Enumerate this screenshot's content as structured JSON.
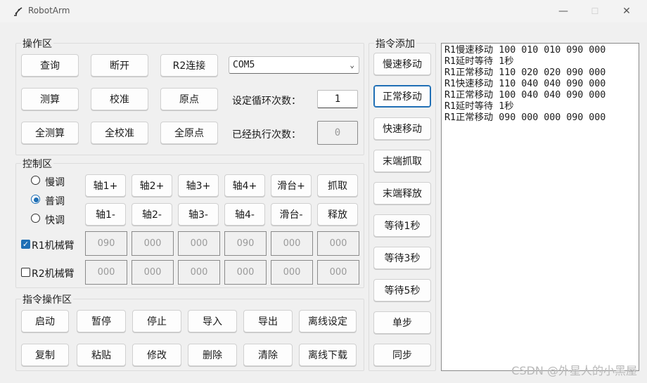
{
  "window": {
    "title": "RobotArm",
    "minimize": "—",
    "maximize": "☐",
    "close": "✕"
  },
  "operation": {
    "title": "操作区",
    "buttons": [
      [
        "查询",
        "断开",
        "R2连接"
      ],
      [
        "测算",
        "校准",
        "原点"
      ],
      [
        "全测算",
        "全校准",
        "全原点"
      ]
    ],
    "port": "COM5",
    "loop_label": "设定循环次数：",
    "loop_value": "1",
    "executed_label": "已经执行次数：",
    "executed_value": "0"
  },
  "control": {
    "title": "控制区",
    "speeds": [
      {
        "label": "慢调",
        "checked": false
      },
      {
        "label": "普调",
        "checked": true
      },
      {
        "label": "快调",
        "checked": false
      }
    ],
    "plus_buttons": [
      "轴1+",
      "轴2+",
      "轴3+",
      "轴4+",
      "滑台+",
      "抓取"
    ],
    "minus_buttons": [
      "轴1-",
      "轴2-",
      "轴3-",
      "轴4-",
      "滑台-",
      "释放"
    ],
    "r1": {
      "label": "R1机械臂",
      "checked": true,
      "values": [
        "090",
        "000",
        "000",
        "090",
        "000",
        "000"
      ]
    },
    "r2": {
      "label": "R2机械臂",
      "checked": false,
      "values": [
        "000",
        "000",
        "000",
        "000",
        "000",
        "000"
      ]
    }
  },
  "command_ops": {
    "title": "指令操作区",
    "row1": [
      "启动",
      "暂停",
      "停止",
      "导入",
      "导出",
      "离线设定"
    ],
    "row2": [
      "复制",
      "粘贴",
      "修改",
      "删除",
      "清除",
      "离线下载"
    ]
  },
  "command_add": {
    "title": "指令添加",
    "buttons": [
      "慢速移动",
      "正常移动",
      "快速移动",
      "末端抓取",
      "末端释放",
      "等待1秒",
      "等待3秒",
      "等待5秒",
      "单步",
      "同步"
    ]
  },
  "commands": [
    "R1慢速移动 100 010 010 090 000",
    "R1延时等待 1秒",
    "R1正常移动 110 020 020 090 000",
    "R1快速移动 110 040 040 090 000",
    "R1正常移动 100 040 040 090 000",
    "R1延时等待 1秒",
    "R1正常移动 090 000 000 090 000"
  ],
  "watermark": "CSDN @外星人的小黑屋",
  "colors": {
    "accent": "#1f6fb5",
    "background": "#f0f0f0"
  }
}
